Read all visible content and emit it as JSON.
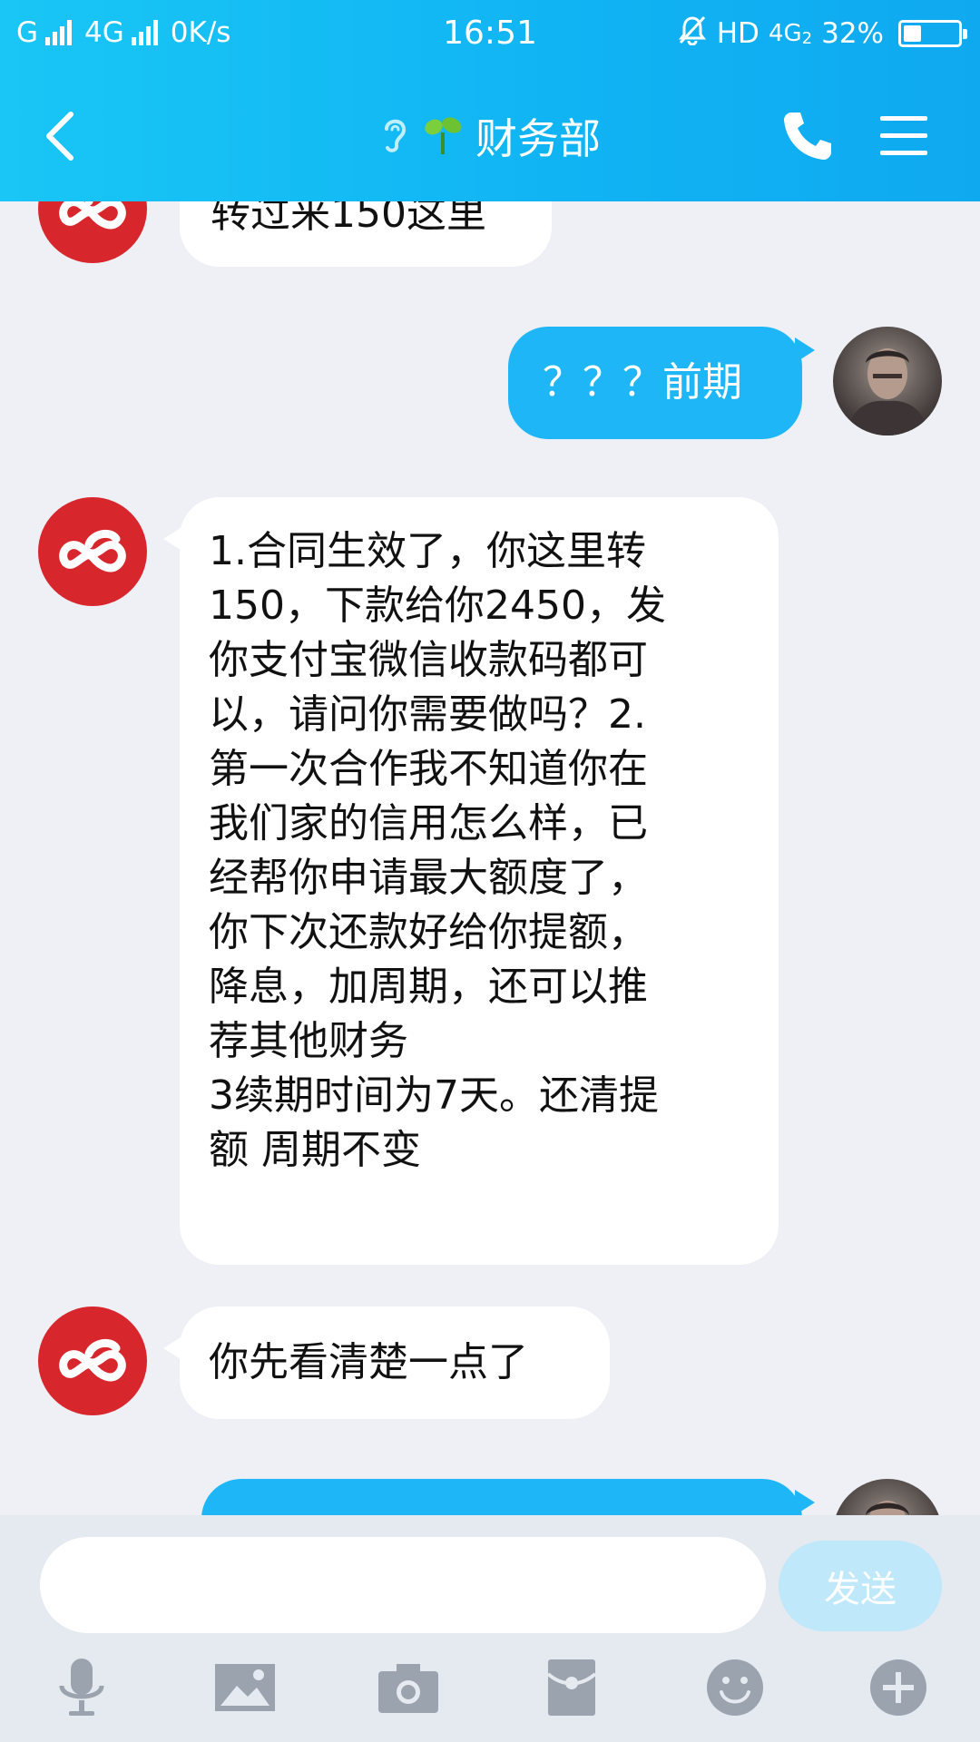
{
  "status_bar": {
    "carrier_g": "G",
    "network": "4G",
    "speed": "0K/s",
    "time": "16:51",
    "hd": "HD",
    "net_right": "4G",
    "sim_slot": "2",
    "battery_text": "32%",
    "battery_level": 0.32
  },
  "header": {
    "title": "财务部",
    "icons": [
      "back-icon",
      "ear-icon",
      "sprout-icon",
      "phone-icon",
      "menu-icon"
    ]
  },
  "messages": [
    {
      "side": "in",
      "text": "转过来150这里"
    },
    {
      "side": "out",
      "text": "？？？前期"
    },
    {
      "side": "in",
      "text": "1.合同生效了，你这里转\n150，下款给你2450，发\n你支付宝微信收款码都可\n以，请问你需要做吗？2.\n第一次合作我不知道你在\n我们家的信用怎么样，已\n经帮你申请最大额度了，\n你下次还款好给你提额，\n降息，加周期，还可以推\n荐其他财务\n3续期时间为7天。还清提\n额 周期不变"
    },
    {
      "side": "in",
      "text": "你先看清楚一点了"
    }
  ],
  "input": {
    "value": "",
    "placeholder": "",
    "send_label": "发送"
  },
  "toolbar": [
    "mic-icon",
    "image-icon",
    "camera-icon",
    "red-packet-icon",
    "emoji-icon",
    "plus-icon"
  ],
  "colors": {
    "header": "#10b3f3",
    "bubble_out": "#1fb6f8",
    "bubble_in": "#ffffff",
    "brand_logo": "#d8262d",
    "background": "#eef0f5"
  }
}
